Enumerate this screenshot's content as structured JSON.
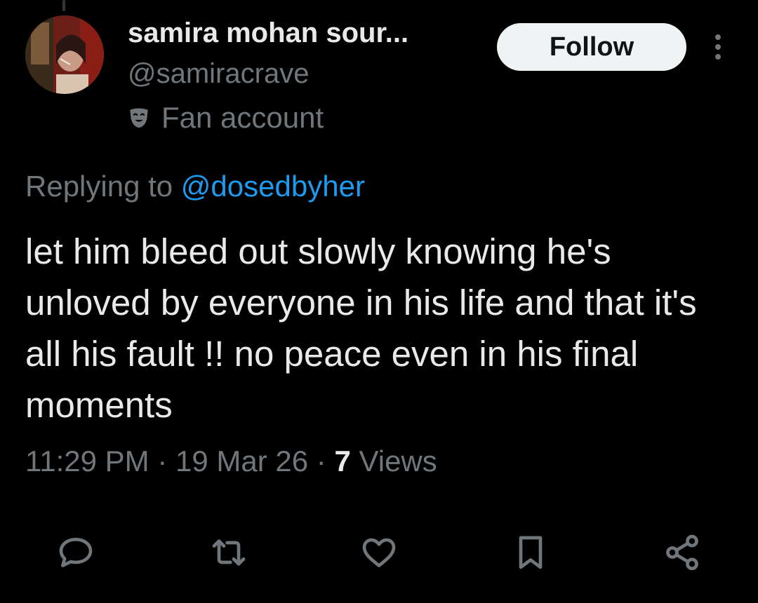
{
  "author": {
    "display_name": "samira mohan sour...",
    "handle": "@samiracrave",
    "badge_label": "Fan account",
    "badge_icon": "theater-mask-icon",
    "avatar": "avatar-photo"
  },
  "follow_button": {
    "label": "Follow"
  },
  "more_icon": "more-vertical-icon",
  "reply_context": {
    "prefix": "Replying to",
    "mention": "@dosedbyher"
  },
  "tweet": {
    "text": "let him bleed out slowly knowing he's unloved by everyone in his life and that it's all his fault !! no peace even in his final moments"
  },
  "meta": {
    "time": "11:29 PM",
    "separator": "·",
    "date": "19 Mar 26",
    "views_count": "7",
    "views_label": "Views"
  },
  "actions": [
    {
      "name": "reply",
      "icon": "reply-bubble-icon"
    },
    {
      "name": "repost",
      "icon": "repost-arrows-icon"
    },
    {
      "name": "like",
      "icon": "heart-icon"
    },
    {
      "name": "bookmark",
      "icon": "bookmark-icon"
    },
    {
      "name": "share",
      "icon": "share-nodes-icon"
    }
  ],
  "colors": {
    "background": "#000000",
    "primary_text": "#e7e9ea",
    "secondary_text": "#71767b",
    "link": "#1d9bf0",
    "follow_bg": "#eff3f4",
    "follow_text": "#0f1419"
  }
}
